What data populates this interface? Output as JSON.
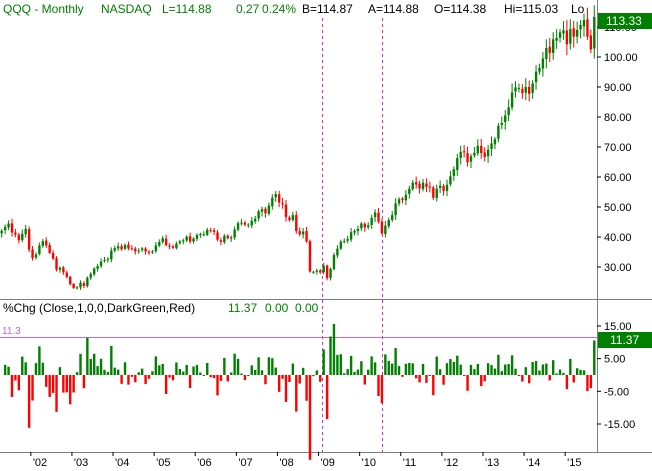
{
  "price_header": {
    "symbol": "QQQ - Monthly",
    "exchange": "NASDAQ",
    "last": "L=114.88",
    "change": "0.27",
    "change_pct": "0.24%",
    "bid": "B=114.87",
    "ask": "A=114.88",
    "open": "O=114.38",
    "high": "Hi=115.03",
    "low_truncated": "Lo"
  },
  "indicator_header": {
    "formula": "%Chg (Close,1,0,0,DarkGreen,Red)",
    "value": "11.37",
    "v2": "0.00",
    "v3": "0.00"
  },
  "last_price_tag": "113.33",
  "last_indicator_tag": "11.37",
  "ref_line_label": "11.3",
  "colors": {
    "header_green": "#008000",
    "up": "#008000",
    "down": "#ff0000",
    "price_tag_bg": "#008000",
    "ref_line": "#cc66cc",
    "vline": "#cc33cc",
    "border": "#7f7f7f"
  },
  "x_ticks": [
    "'02",
    "'03",
    "'04",
    "'05",
    "'06",
    "'07",
    "'08",
    "'09",
    "'10",
    "'11",
    "'12",
    "'13",
    "'14",
    "'15"
  ],
  "chart_data": [
    {
      "type": "candlestick",
      "title": "QQQ - Monthly",
      "y_ticks": [
        30,
        40,
        50,
        60,
        70,
        80,
        90,
        100,
        110
      ],
      "y_tick_labels": [
        "30.00",
        "40.00",
        "50.00",
        "60.00",
        "70.00",
        "80.00",
        "90.00",
        "100.00",
        "110.00"
      ],
      "ylim": [
        20,
        118
      ],
      "x_start": 2001.25,
      "x_step_months": 1,
      "closes": [
        42.1,
        43.4,
        44.5,
        41.5,
        40.8,
        38.9,
        41.1,
        42.7,
        35.8,
        33.0,
        34.2,
        37.2,
        38.6,
        37.2,
        34.7,
        32.8,
        29.1,
        29.8,
        28.2,
        26.7,
        24.3,
        23.0,
        23.2,
        24.7,
        23.7,
        26.4,
        27.7,
        29.5,
        30.3,
        31.8,
        32.3,
        32.6,
        35.5,
        36.3,
        36.9,
        35.9,
        37.3,
        36.2,
        36.0,
        35.2,
        35.5,
        36.2,
        35.2,
        34.8,
        35.2,
        37.2,
        38.3,
        39.6,
        37.3,
        37.0,
        36.4,
        37.8,
        38.5,
        38.9,
        40.1,
        38.5,
        39.5,
        40.7,
        41.0,
        40.9,
        42.4,
        42.1,
        41.7,
        39.1,
        38.4,
        40.4,
        39.6,
        39.9,
        42.5,
        44.6,
        44.8,
        44.1,
        44.1,
        45.4,
        46.1,
        48.6,
        49.3,
        47.9,
        50.5,
        53.1,
        54.3,
        51.5,
        50.9,
        46.7,
        45.7,
        47.3,
        42.0,
        40.9,
        41.8,
        38.5,
        28.5,
        28.4,
        28.8,
        28.2,
        30.4,
        26.3,
        29.4,
        34.0,
        36.1,
        38.4,
        38.6,
        39.3,
        41.6,
        42.0,
        42.7,
        44.5,
        43.2,
        43.9,
        46.4,
        48.2,
        45.1,
        41.2,
        43.8,
        45.7,
        47.3,
        51.2,
        52.6,
        52.3,
        54.1,
        56.1,
        58.1,
        57.5,
        56.2,
        58.1,
        56.7,
        56.6,
        53.1,
        56.1,
        57.1,
        55.4,
        57.4,
        60.2,
        62.6,
        66.3,
        68.4,
        68.2,
        64.9,
        66.9,
        68.1,
        70.4,
        68.0,
        66.7,
        69.1,
        71.2,
        72.6,
        77.1,
        78.0,
        80.5,
        83.2,
        88.2,
        89.9,
        89.7,
        87.9,
        90.0,
        87.7,
        91.2,
        95.1,
        96.4,
        99.5,
        103.0,
        101.3,
        105.9,
        106.4,
        108.2,
        108.9,
        104.2,
        109.3,
        106.8,
        109.0,
        110.7,
        112.3,
        106.8,
        102.5,
        113.33
      ]
    },
    {
      "type": "bar",
      "title": "%Chg (Close,1,0,0,DarkGreen,Red)",
      "y_ticks": [
        15,
        5,
        -5,
        -15
      ],
      "y_tick_labels": [
        "15.00",
        "5.00",
        "-5.00",
        "-15.00"
      ],
      "ylim": [
        -21,
        20
      ],
      "reference_line": 11.37
    }
  ]
}
